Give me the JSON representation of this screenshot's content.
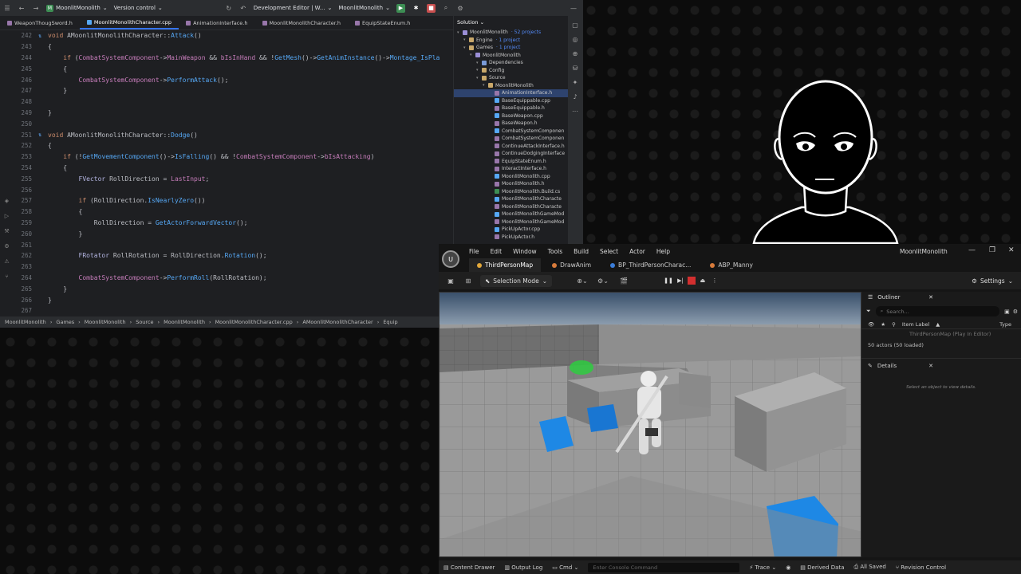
{
  "ide": {
    "project": "MoonlitMonolith",
    "vcs": "Version control",
    "run_config": "Development Editor | W...",
    "target": "MoonlitMonolith",
    "tabs": [
      "WeaponThougSword.h",
      "MoonlitMonolithCharacter.cpp",
      "AnimationInterface.h",
      "MoonlitMonolithCharacter.h",
      "EquipStateEnum.h"
    ],
    "code_lines": [
      {
        "n": "242",
        "mark": "⇅",
        "parts": [
          [
            "kw",
            "void "
          ],
          [
            "cls",
            "AMoonlitMonolithCharacter::"
          ],
          [
            "fn",
            "Attack"
          ],
          [
            "tx",
            "()"
          ]
        ]
      },
      {
        "n": "243",
        "mark": "",
        "parts": [
          [
            "tx",
            "{"
          ]
        ]
      },
      {
        "n": "244",
        "mark": "",
        "parts": [
          [
            "tx",
            "    "
          ],
          [
            "kw",
            "if "
          ],
          [
            "tx",
            "("
          ],
          [
            "mem",
            "CombatSystemComponent"
          ],
          [
            "tx",
            "->"
          ],
          [
            "mem",
            "MainWeapon"
          ],
          [
            "tx",
            " && "
          ],
          [
            "mem",
            "bIsInHand"
          ],
          [
            "tx",
            " && !"
          ],
          [
            "fnc",
            "GetMesh"
          ],
          [
            "tx",
            "()->"
          ],
          [
            "fnc",
            "GetAnimInstance"
          ],
          [
            "tx",
            "()->"
          ],
          [
            "fnc",
            "Montage_IsPla"
          ]
        ]
      },
      {
        "n": "245",
        "mark": "",
        "parts": [
          [
            "tx",
            "    {"
          ]
        ]
      },
      {
        "n": "246",
        "mark": "",
        "parts": [
          [
            "tx",
            "        "
          ],
          [
            "mem",
            "CombatSystemComponent"
          ],
          [
            "tx",
            "->"
          ],
          [
            "fnc",
            "PerformAttack"
          ],
          [
            "tx",
            "();"
          ]
        ]
      },
      {
        "n": "247",
        "mark": "",
        "parts": [
          [
            "tx",
            "    }"
          ]
        ]
      },
      {
        "n": "248",
        "mark": "",
        "parts": [
          [
            "tx",
            ""
          ]
        ]
      },
      {
        "n": "249",
        "mark": "",
        "parts": [
          [
            "tx",
            "}"
          ]
        ]
      },
      {
        "n": "250",
        "mark": "",
        "parts": [
          [
            "tx",
            ""
          ]
        ]
      },
      {
        "n": "251",
        "mark": "⇅",
        "parts": [
          [
            "kw",
            "void "
          ],
          [
            "cls",
            "AMoonlitMonolithCharacter::"
          ],
          [
            "fn",
            "Dodge"
          ],
          [
            "tx",
            "()"
          ]
        ]
      },
      {
        "n": "252",
        "mark": "",
        "parts": [
          [
            "tx",
            "{"
          ]
        ]
      },
      {
        "n": "253",
        "mark": "",
        "parts": [
          [
            "tx",
            "    "
          ],
          [
            "kw",
            "if "
          ],
          [
            "tx",
            "(!"
          ],
          [
            "fnc",
            "GetMovementComponent"
          ],
          [
            "tx",
            "()->"
          ],
          [
            "fnc",
            "IsFalling"
          ],
          [
            "tx",
            "() && !"
          ],
          [
            "mem",
            "CombatSystemComponent"
          ],
          [
            "tx",
            "->"
          ],
          [
            "mem",
            "bIsAttacking"
          ],
          [
            "tx",
            ")"
          ]
        ]
      },
      {
        "n": "254",
        "mark": "",
        "parts": [
          [
            "tx",
            "    {"
          ]
        ]
      },
      {
        "n": "255",
        "mark": "",
        "parts": [
          [
            "tx",
            "        "
          ],
          [
            "ty",
            "FVector "
          ],
          [
            "tx",
            "RollDirection = "
          ],
          [
            "mem",
            "LastInput"
          ],
          [
            "tx",
            ";"
          ]
        ]
      },
      {
        "n": "256",
        "mark": "",
        "parts": [
          [
            "tx",
            ""
          ]
        ]
      },
      {
        "n": "257",
        "mark": "",
        "parts": [
          [
            "tx",
            "        "
          ],
          [
            "kw",
            "if "
          ],
          [
            "tx",
            "(RollDirection."
          ],
          [
            "fnc",
            "IsNearlyZero"
          ],
          [
            "tx",
            "())"
          ]
        ]
      },
      {
        "n": "258",
        "mark": "",
        "parts": [
          [
            "tx",
            "        {"
          ]
        ]
      },
      {
        "n": "259",
        "mark": "",
        "parts": [
          [
            "tx",
            "            RollDirection = "
          ],
          [
            "fnc",
            "GetActorForwardVector"
          ],
          [
            "tx",
            "();"
          ]
        ]
      },
      {
        "n": "260",
        "mark": "",
        "parts": [
          [
            "tx",
            "        }"
          ]
        ]
      },
      {
        "n": "261",
        "mark": "",
        "parts": [
          [
            "tx",
            ""
          ]
        ]
      },
      {
        "n": "262",
        "mark": "",
        "parts": [
          [
            "tx",
            "        "
          ],
          [
            "ty",
            "FRotator "
          ],
          [
            "tx",
            "RollRotation = RollDirection."
          ],
          [
            "fnc",
            "Rotation"
          ],
          [
            "tx",
            "();"
          ]
        ]
      },
      {
        "n": "263",
        "mark": "",
        "parts": [
          [
            "tx",
            ""
          ]
        ]
      },
      {
        "n": "264",
        "mark": "",
        "parts": [
          [
            "tx",
            "        "
          ],
          [
            "mem",
            "CombatSystemComponent"
          ],
          [
            "tx",
            "->"
          ],
          [
            "fnc",
            "PerformRoll"
          ],
          [
            "tx",
            "(RollRotation);"
          ]
        ]
      },
      {
        "n": "265",
        "mark": "",
        "parts": [
          [
            "tx",
            "    }"
          ]
        ]
      },
      {
        "n": "266",
        "mark": "",
        "parts": [
          [
            "tx",
            "}"
          ]
        ]
      },
      {
        "n": "267",
        "mark": "",
        "parts": [
          [
            "tx",
            ""
          ]
        ]
      }
    ],
    "breadcrumb": [
      "MoonlitMonolith",
      "Games",
      "MoonlitMonolith",
      "Source",
      "MoonlitMonolith",
      "MoonlitMonolithCharacter.cpp",
      "AMoonlitMonolithCharacter",
      "Equip"
    ]
  },
  "solution": {
    "header": "Solution",
    "tree": [
      {
        "d": 0,
        "label": "MoonlitMonolith",
        "sub": "· 52 projects",
        "c": "#9b8fd6"
      },
      {
        "d": 1,
        "label": "Engine",
        "sub": "· 1 project",
        "c": "#c9a86a"
      },
      {
        "d": 1,
        "label": "Games",
        "sub": "· 1 project",
        "c": "#c9a86a"
      },
      {
        "d": 2,
        "label": "MoonlitMonolith",
        "sub": "",
        "c": "#9b8fd6"
      },
      {
        "d": 3,
        "label": "Dependencies",
        "sub": "",
        "c": "#7a9bd6"
      },
      {
        "d": 3,
        "label": "Config",
        "sub": "",
        "c": "#c9a86a"
      },
      {
        "d": 3,
        "label": "Source",
        "sub": "",
        "c": "#c9a86a"
      },
      {
        "d": 4,
        "label": "MoonlitMonolith",
        "sub": "",
        "c": "#c9a86a"
      },
      {
        "d": 5,
        "label": "AnimationInterface.h",
        "sub": "",
        "c": "#9876aa",
        "sel": true
      },
      {
        "d": 5,
        "label": "BaseEquippable.cpp",
        "sub": "",
        "c": "#56a8f5"
      },
      {
        "d": 5,
        "label": "BaseEquippable.h",
        "sub": "",
        "c": "#9876aa"
      },
      {
        "d": 5,
        "label": "BaseWeapon.cpp",
        "sub": "",
        "c": "#56a8f5"
      },
      {
        "d": 5,
        "label": "BaseWeapon.h",
        "sub": "",
        "c": "#9876aa"
      },
      {
        "d": 5,
        "label": "CombatSystemComponen",
        "sub": "",
        "c": "#56a8f5"
      },
      {
        "d": 5,
        "label": "CombatSystemComponen",
        "sub": "",
        "c": "#9876aa"
      },
      {
        "d": 5,
        "label": "ContinueAttackInterface.h",
        "sub": "",
        "c": "#9876aa"
      },
      {
        "d": 5,
        "label": "ContinueDodgingInterface",
        "sub": "",
        "c": "#9876aa"
      },
      {
        "d": 5,
        "label": "EquipStateEnum.h",
        "sub": "",
        "c": "#9876aa"
      },
      {
        "d": 5,
        "label": "InteractInterface.h",
        "sub": "",
        "c": "#9876aa"
      },
      {
        "d": 5,
        "label": "MoonlitMonolith.cpp",
        "sub": "",
        "c": "#56a8f5"
      },
      {
        "d": 5,
        "label": "MoonlitMonolith.h",
        "sub": "",
        "c": "#9876aa"
      },
      {
        "d": 5,
        "label": "MoonlitMonolith.Build.cs",
        "sub": "",
        "c": "#3d8e54"
      },
      {
        "d": 5,
        "label": "MoonlitMonolithCharacte",
        "sub": "",
        "c": "#56a8f5"
      },
      {
        "d": 5,
        "label": "MoonlitMonolithCharacte",
        "sub": "",
        "c": "#9876aa"
      },
      {
        "d": 5,
        "label": "MoonlitMonolithGameMod",
        "sub": "",
        "c": "#56a8f5"
      },
      {
        "d": 5,
        "label": "MoonlitMonolithGameMod",
        "sub": "",
        "c": "#9876aa"
      },
      {
        "d": 5,
        "label": "PickUpActor.cpp",
        "sub": "",
        "c": "#56a8f5"
      },
      {
        "d": 5,
        "label": "PickUpActor.h",
        "sub": "",
        "c": "#9876aa"
      }
    ]
  },
  "ue": {
    "menu": [
      "File",
      "Edit",
      "Window",
      "Tools",
      "Build",
      "Select",
      "Actor",
      "Help"
    ],
    "title": "MoonlitMonolith",
    "tabs": [
      "ThirdPersonMap",
      "DrawAnim",
      "BP_ThirdPersonCharac...",
      "ABP_Manny"
    ],
    "mode": "Selection Mode",
    "settings": "Settings",
    "outliner": {
      "title": "Outliner",
      "search_placeholder": "Search...",
      "col_label": "Item Label",
      "col_type": "Type",
      "row": "ThirdPersonMap (Play In Editor)",
      "count": "50 actors (50 loaded)"
    },
    "details": {
      "title": "Details",
      "empty": "Select an object to view details."
    },
    "status": {
      "content_drawer": "Content Drawer",
      "output_log": "Output Log",
      "cmd": "Cmd",
      "console_placeholder": "Enter Console Command",
      "trace": "Trace",
      "derived": "Derived Data",
      "saved": "All Saved",
      "revision": "Revision Control"
    }
  },
  "colors": {
    "accent": "#3574f0",
    "cube": "#1e88e5",
    "stop": "#d32f2f",
    "vcs_green": "#3d8e54"
  }
}
